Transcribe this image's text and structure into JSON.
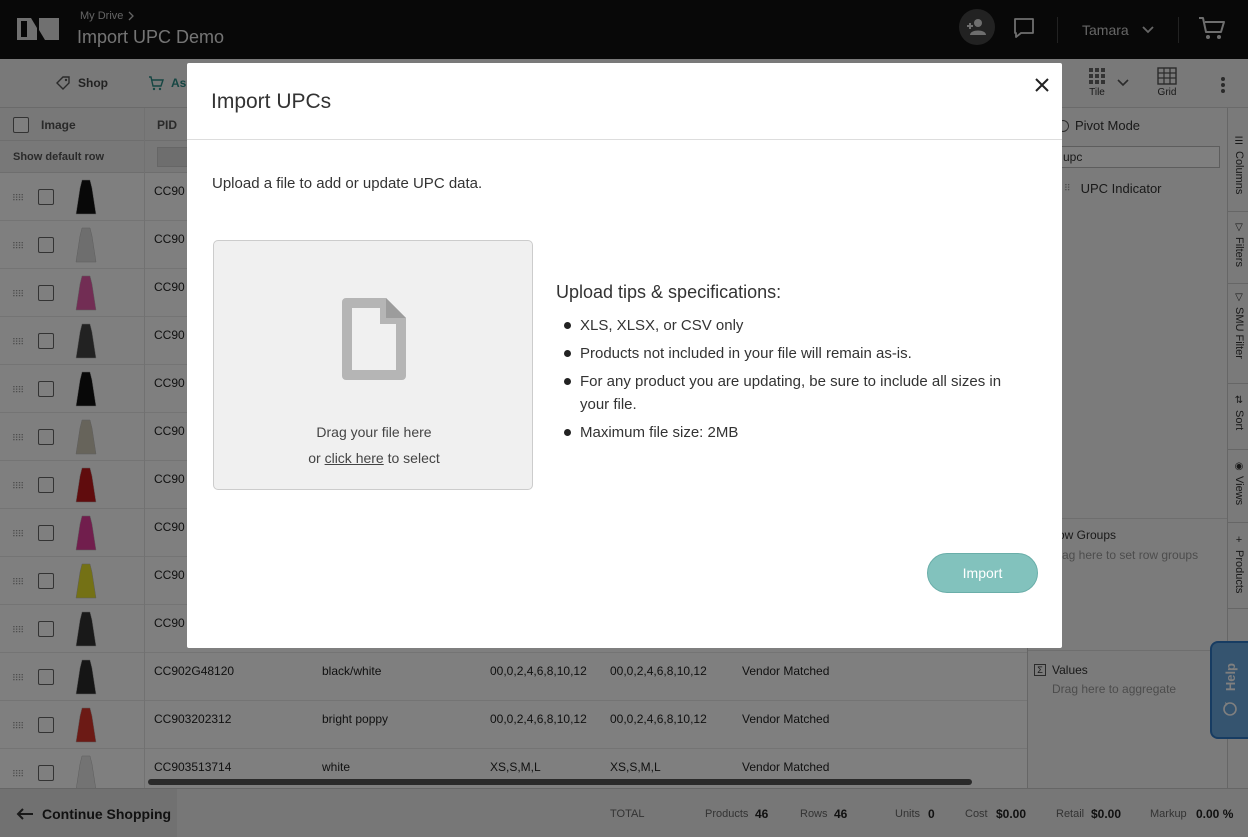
{
  "header": {
    "breadcrumb": "My Drive",
    "title": "Import UPC Demo",
    "user_name": "Tamara",
    "icons": [
      "logo",
      "add-user-icon",
      "chat-icon",
      "chevron-down-icon",
      "cart-icon"
    ]
  },
  "toolbar": {
    "tabs": [
      {
        "label": "Shop",
        "icon": "tag-icon"
      },
      {
        "label": "As",
        "icon": "cart-icon"
      }
    ],
    "view_buttons": [
      {
        "label": "Tile",
        "icon": "tile-icon"
      },
      {
        "label": "Grid",
        "icon": "grid-icon"
      }
    ]
  },
  "grid": {
    "headers": {
      "image": "Image",
      "pid": "PID"
    },
    "show_default_row": "Show default row",
    "rows": [
      {
        "pid": "CC90",
        "color": "",
        "sizes1": "",
        "sizes2": "",
        "status": "",
        "thumb_color": "#111111"
      },
      {
        "pid": "CC90",
        "color": "",
        "sizes1": "",
        "sizes2": "",
        "status": "",
        "thumb_color": "#dddddd"
      },
      {
        "pid": "CC90",
        "color": "",
        "sizes1": "",
        "sizes2": "",
        "status": "",
        "thumb_color": "#e55aa8"
      },
      {
        "pid": "CC90",
        "color": "",
        "sizes1": "",
        "sizes2": "",
        "status": "",
        "thumb_color": "#444444"
      },
      {
        "pid": "CC90",
        "color": "",
        "sizes1": "",
        "sizes2": "",
        "status": "",
        "thumb_color": "#111111"
      },
      {
        "pid": "CC90",
        "color": "",
        "sizes1": "",
        "sizes2": "",
        "status": "",
        "thumb_color": "#cfc8b6"
      },
      {
        "pid": "CC90",
        "color": "",
        "sizes1": "",
        "sizes2": "",
        "status": "",
        "thumb_color": "#c0181b"
      },
      {
        "pid": "CC90",
        "color": "",
        "sizes1": "",
        "sizes2": "",
        "status": "",
        "thumb_color": "#e33c9b"
      },
      {
        "pid": "CC90",
        "color": "",
        "sizes1": "",
        "sizes2": "",
        "status": "",
        "thumb_color": "#e8e22a"
      },
      {
        "pid": "CC90",
        "color": "",
        "sizes1": "",
        "sizes2": "",
        "status": "",
        "thumb_color": "#333333"
      },
      {
        "pid": "CC902G48120",
        "color": "black/white",
        "sizes1": "00,0,2,4,6,8,10,12",
        "sizes2": "00,0,2,4,6,8,10,12",
        "status": "Vendor Matched",
        "thumb_color": "#2a2a2a"
      },
      {
        "pid": "CC903202312",
        "color": "bright poppy",
        "sizes1": "00,0,2,4,6,8,10,12",
        "sizes2": "00,0,2,4,6,8,10,12",
        "status": "Vendor Matched",
        "thumb_color": "#d8352a"
      },
      {
        "pid": "CC903513714",
        "color": "white",
        "sizes1": "XS,S,M,L",
        "sizes2": "XS,S,M,L",
        "status": "Vendor Matched",
        "thumb_color": "#e6e6e6"
      }
    ]
  },
  "side_panel": {
    "pivot_mode": "Pivot Mode",
    "search_value": "upc",
    "column_item": "UPC Indicator",
    "row_groups_title": "ow Groups",
    "row_groups_hint": "rag here to set row groups",
    "values_title": "Values",
    "values_hint": "Drag here to aggregate"
  },
  "side_tabs": [
    "Columns",
    "Filters",
    "SMU Filter",
    "Sort",
    "Views",
    "Products"
  ],
  "help_label": "Help",
  "footer": {
    "continue": "Continue Shopping",
    "total_label": "TOTAL",
    "products_label": "Products",
    "products_value": "46",
    "rows_label": "Rows",
    "rows_value": "46",
    "units_label": "Units",
    "units_value": "0",
    "cost_label": "Cost",
    "cost_value": "$0.00",
    "retail_label": "Retail",
    "retail_value": "$0.00",
    "markup_label": "Markup",
    "markup_value": "0.00 %"
  },
  "modal": {
    "title": "Import UPCs",
    "description": "Upload a file to add or update UPC data.",
    "drop_line1": "Drag your file here",
    "drop_or": "or",
    "drop_link": "click here",
    "drop_suffix": "to select",
    "tips_title": "Upload tips & specifications:",
    "tips": [
      "XLS, XLSX, or CSV only",
      "Products not included in your file will remain as-is.",
      "For any product you are updating, be sure to include all sizes in your file.",
      "Maximum file size: 2MB"
    ],
    "import_label": "Import",
    "import_color": "#82c2bd"
  }
}
